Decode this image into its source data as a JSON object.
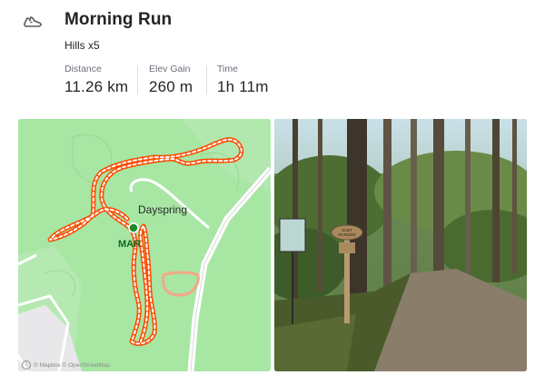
{
  "activity": {
    "icon": "running-shoe-icon",
    "title": "Morning Run",
    "description": "Hills x5"
  },
  "stats": [
    {
      "label": "Distance",
      "value": "11.26 km"
    },
    {
      "label": "Elev Gain",
      "value": "260 m"
    },
    {
      "label": "Time",
      "value": "1h 11m"
    }
  ],
  "map": {
    "place_label": "Dayspring",
    "marker_label": "MAR",
    "attribution": "© Mapbox © OpenStreetMap",
    "colors": {
      "land": "#a8e6a4",
      "road": "#ffffff",
      "route": "#fc4c02"
    }
  },
  "photo": {
    "sign_text": "ELBT RANGER"
  }
}
